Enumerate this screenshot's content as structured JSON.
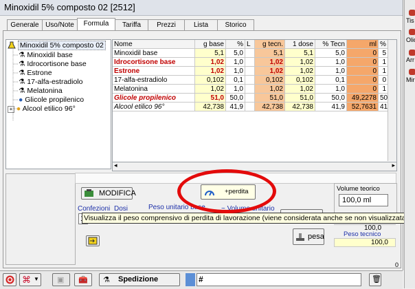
{
  "window": {
    "title": "Minoxidil 5% composto 02  [2512]"
  },
  "right_strip": {
    "items": [
      "Tis",
      "Olio",
      "Arr",
      "Mir"
    ]
  },
  "tabs": [
    {
      "label": "Generale"
    },
    {
      "label": "Uso/Note"
    },
    {
      "label": "Formula",
      "active": true
    },
    {
      "label": "Tariffa"
    },
    {
      "label": "Prezzi"
    },
    {
      "label": "Lista"
    },
    {
      "label": "Storico"
    }
  ],
  "tree": {
    "root": "Minoxidil 5% composto 02",
    "children": [
      "Minoxidil base",
      "Idrocortisone base",
      "Estrone",
      "17-alfa-estradiolo",
      "Melatonina",
      "Glicole propilenico",
      "Alcool etilico 96°"
    ]
  },
  "grid": {
    "headers": [
      "Nome",
      "g base",
      "%",
      "L",
      "g tecn.",
      "1 dose",
      "% Tecn",
      "ml",
      "% E"
    ],
    "rows": [
      {
        "nome": "Minoxidil base",
        "gbase": "5,1",
        "pct": "5,0",
        "gtecn": "5,1",
        "dose": "5,1",
        "pcttecn": "5,0",
        "ml": "0",
        "e": "5",
        "style": "normal"
      },
      {
        "nome": "Idrocortisone base",
        "gbase": "1,02",
        "pct": "1,0",
        "gtecn": "1,02",
        "dose": "1,02",
        "pcttecn": "1,0",
        "ml": "0",
        "e": "1",
        "style": "redbold"
      },
      {
        "nome": "Estrone",
        "gbase": "1,02",
        "pct": "1,0",
        "gtecn": "1,02",
        "dose": "1,02",
        "pcttecn": "1,0",
        "ml": "0",
        "e": "1",
        "style": "redbold"
      },
      {
        "nome": "17-alfa-estradiolo",
        "gbase": "0,102",
        "pct": "0,1",
        "gtecn": "0,102",
        "dose": "0,102",
        "pcttecn": "0,1",
        "ml": "0",
        "e": "0",
        "style": "normal"
      },
      {
        "nome": "Melatonina",
        "gbase": "1,02",
        "pct": "1,0",
        "gtecn": "1,02",
        "dose": "1,02",
        "pcttecn": "1,0",
        "ml": "0",
        "e": "1",
        "style": "normal"
      },
      {
        "nome": "Glicole propilenico",
        "gbase": "51,0",
        "pct": "50,0",
        "gtecn": "51,0",
        "dose": "51,0",
        "pcttecn": "50,0",
        "ml": "49,2278",
        "e": "50",
        "style": "reditalic"
      },
      {
        "nome": "Alcool etilico 96°",
        "gbase": "42,738",
        "pct": "41,9",
        "gtecn": "42,738",
        "dose": "42,738",
        "pcttecn": "41,9",
        "ml": "52,7631",
        "e": "41",
        "style": "italic"
      }
    ]
  },
  "bottom": {
    "modifica_label": "MODIFICA",
    "perdita_label": "+perdita",
    "volume_teorico_label": "Volume teorico",
    "volume_teorico_value": "100,0 ml",
    "confezioni_label": "Confezioni",
    "dosi_label": "Dosi",
    "peso_unitario_label": "Peso unitario base",
    "volume_unitario_label": "~ Volume unitario",
    "confezioni_value": "1",
    "peso_value_1": "100,0",
    "peso_tecnico_label": "Peso tecnico",
    "peso_tecnico_value": "100,0",
    "pesa_label": "pesa",
    "tooltip": "Visualizza il peso comprensivo di perdita di lavorazione (viene considerata anche se non visualizzata)"
  },
  "statusbar": {
    "spedizione_label": "Spedizione",
    "hash_label": "#",
    "counter": "0"
  },
  "colors": {
    "red_text": "#c00000",
    "yellow_cell": "#ffffcc",
    "orange_cell": "#f8c79a",
    "highlight_ellipse": "#e30b0b"
  }
}
